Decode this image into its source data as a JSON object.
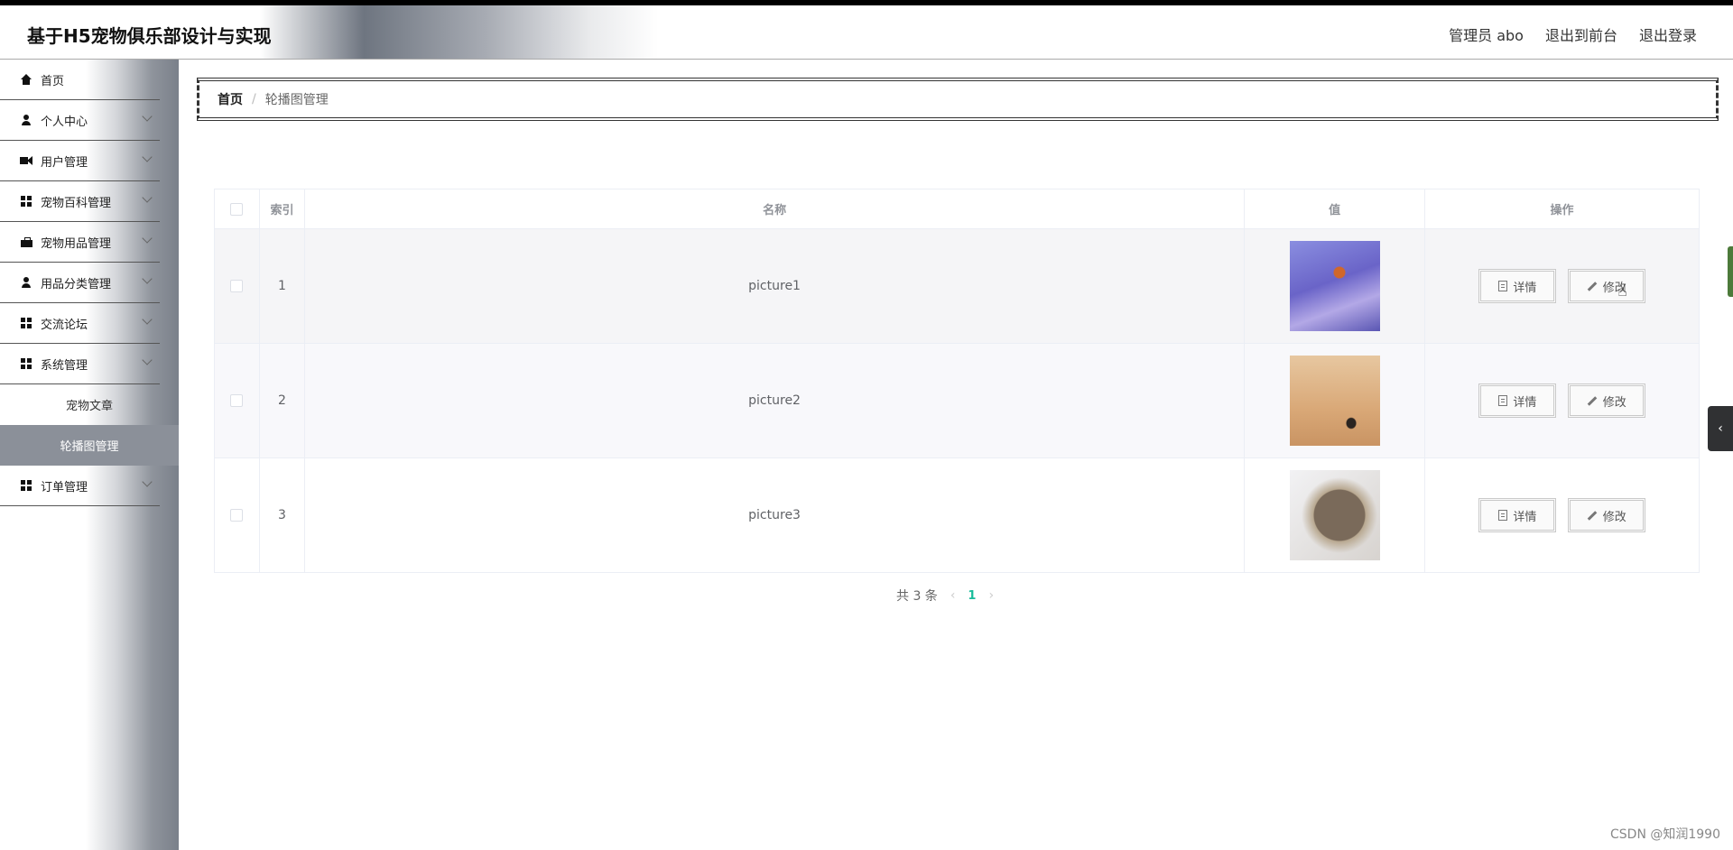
{
  "header": {
    "title": "基于H5宠物俱乐部设计与实现",
    "links": [
      "管理员 abo",
      "退出到前台",
      "退出登录"
    ]
  },
  "sidebar": {
    "items": [
      {
        "label": "首页",
        "icon": "home-icon"
      },
      {
        "label": "个人中心",
        "icon": "user-icon"
      },
      {
        "label": "用户管理",
        "icon": "video-icon"
      },
      {
        "label": "宠物百科管理",
        "icon": "grid-icon"
      },
      {
        "label": "宠物用品管理",
        "icon": "briefcase-icon"
      },
      {
        "label": "用品分类管理",
        "icon": "user-icon"
      },
      {
        "label": "交流论坛",
        "icon": "grid-icon"
      },
      {
        "label": "系统管理",
        "icon": "grid-icon"
      },
      {
        "label": "订单管理",
        "icon": "grid-icon"
      }
    ],
    "sub_items": [
      "宠物文章",
      "轮播图管理"
    ]
  },
  "breadcrumb": {
    "home": "首页",
    "separator": "/",
    "current": "轮播图管理"
  },
  "table": {
    "headers": [
      "索引",
      "名称",
      "值",
      "操作"
    ],
    "rows": [
      {
        "index": "1",
        "name": "picture1"
      },
      {
        "index": "2",
        "name": "picture2"
      },
      {
        "index": "3",
        "name": "picture3"
      }
    ],
    "actions": {
      "detail": "详情",
      "edit": "修改"
    }
  },
  "pagination": {
    "total": "共 3 条",
    "prev": "‹",
    "page": "1",
    "next": "›"
  },
  "side_toggle": "‹",
  "watermark": "CSDN @知润1990",
  "colors": {
    "accent": "#1abc9c",
    "active_menu": "#8b9099",
    "sidebar_dark": "#7a808a"
  }
}
